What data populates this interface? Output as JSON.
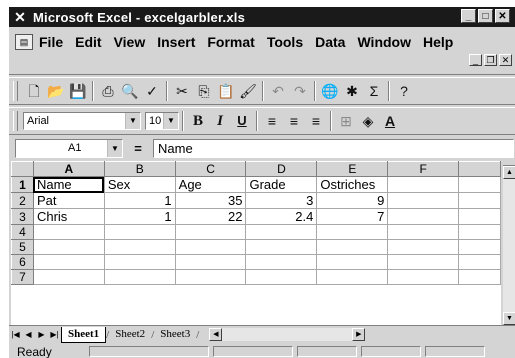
{
  "window": {
    "app_icon": "excel-icon",
    "title": "Microsoft Excel - excelgarbler.xls"
  },
  "menu": [
    "File",
    "Edit",
    "View",
    "Insert",
    "Format",
    "Tools",
    "Data",
    "Window",
    "Help"
  ],
  "format": {
    "font": "Arial",
    "size": "10"
  },
  "toolbar_text": {
    "sum": "Σ",
    "help": "?"
  },
  "formula_bar": {
    "cell_ref": "A1",
    "equals": "=",
    "content": "Name"
  },
  "grid": {
    "columns": [
      "A",
      "B",
      "C",
      "D",
      "E",
      "F"
    ],
    "row_numbers": [
      "1",
      "2",
      "3",
      "4",
      "5",
      "6",
      "7"
    ],
    "rows": [
      [
        "Name",
        "Sex",
        "Age",
        "Grade",
        "Ostriches",
        ""
      ],
      [
        "Pat",
        "1",
        "35",
        "3",
        "9",
        ""
      ],
      [
        "Chris",
        "1",
        "22",
        "2.4",
        "7",
        ""
      ],
      [
        "",
        "",
        "",
        "",
        "",
        ""
      ],
      [
        "",
        "",
        "",
        "",
        "",
        ""
      ],
      [
        "",
        "",
        "",
        "",
        "",
        ""
      ],
      [
        "",
        "",
        "",
        "",
        "",
        ""
      ]
    ],
    "selected_cell": "A1"
  },
  "sheets": {
    "tabs": [
      "Sheet1",
      "Sheet2",
      "Sheet3"
    ],
    "active": "Sheet1"
  },
  "status": {
    "text": "Ready"
  }
}
